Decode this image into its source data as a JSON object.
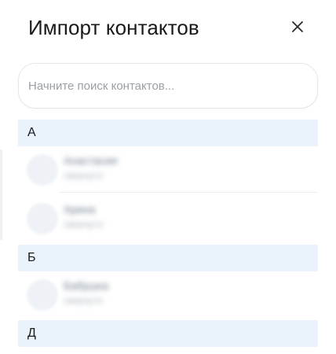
{
  "dialog": {
    "title": "Импорт контактов",
    "close_icon": "close-icon",
    "close_glyph": "✕"
  },
  "search": {
    "placeholder": "Начните поиск контактов...",
    "value": ""
  },
  "sections": [
    {
      "letter": "А",
      "contacts": [
        {
          "name": "Анастасия",
          "sub": "свернуто"
        },
        {
          "name": "Арина",
          "sub": "свернуто"
        }
      ]
    },
    {
      "letter": "Б",
      "contacts": [
        {
          "name": "Бабушка",
          "sub": "свернуто"
        }
      ]
    },
    {
      "letter": "Д",
      "contacts": []
    }
  ],
  "colors": {
    "section_bg": "#eaf3fb",
    "title_text": "#1a1a1a",
    "placeholder_text": "#9aa0a6",
    "border": "#e3e6ea"
  }
}
